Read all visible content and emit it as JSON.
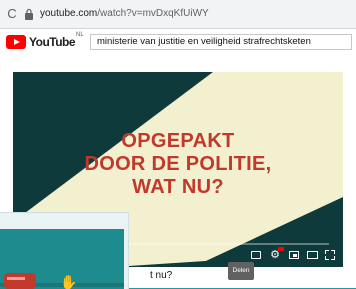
{
  "browser": {
    "reload_icon": "reload-icon",
    "url_domain": "youtube.com",
    "url_path": "/watch?v=mvDxqKfUiWY"
  },
  "youtube": {
    "logo_text": "YouTube",
    "country_code": "NL",
    "search_value": "ministerie van justitie en veiligheid strafrechtsketen"
  },
  "video": {
    "headline_lines": [
      "OPGEPAKT",
      "DOOR DE POLITIE,",
      "WAT NU?"
    ],
    "progress": 0.04,
    "title_partial": "t nu?",
    "tooltip": "Delen"
  },
  "colors": {
    "accent_red": "#c0392b",
    "teal": "#1f9aa0",
    "dark_teal": "#0e3a3b",
    "cream": "#f3f0d0"
  }
}
